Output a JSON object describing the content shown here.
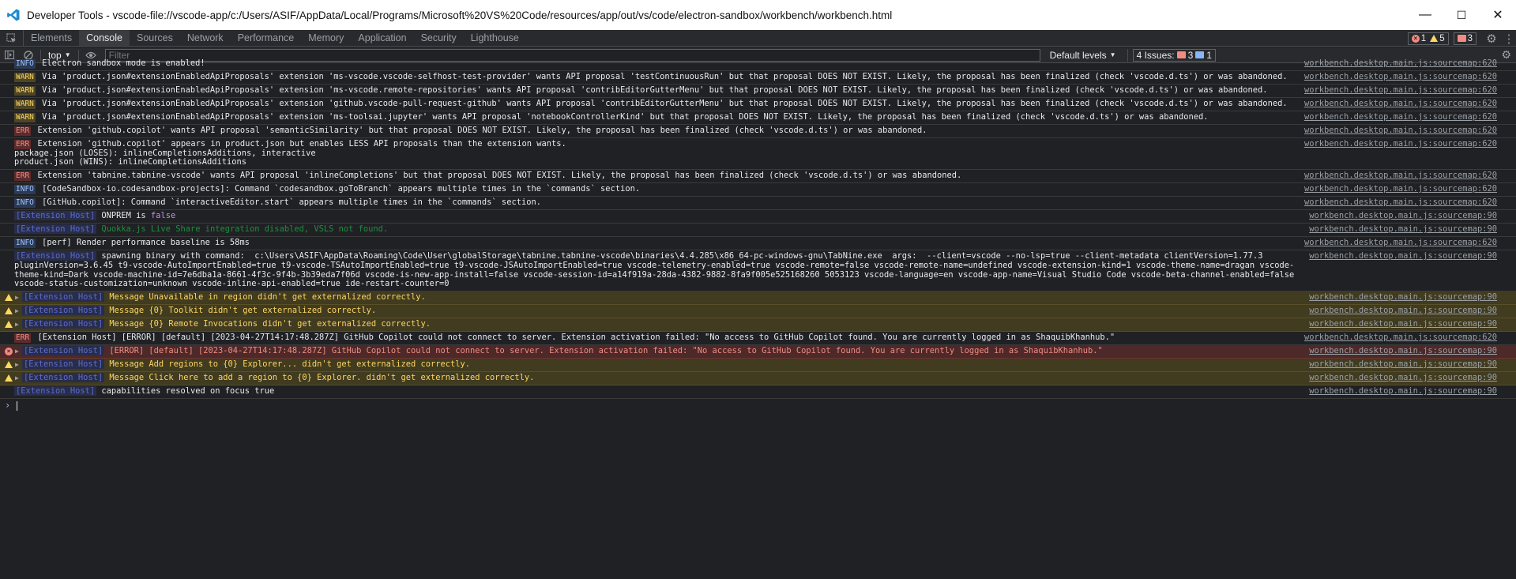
{
  "window": {
    "title": "Developer Tools - vscode-file://vscode-app/c:/Users/ASIF/AppData/Local/Programs/Microsoft%20VS%20Code/resources/app/out/vs/code/electron-sandbox/workbench/workbench.html",
    "minimize": "—",
    "maximize": "☐",
    "close": "✕",
    "icon": "vscode-icon"
  },
  "tabs": [
    {
      "label": "Elements"
    },
    {
      "label": "Console",
      "active": true
    },
    {
      "label": "Sources"
    },
    {
      "label": "Network"
    },
    {
      "label": "Performance"
    },
    {
      "label": "Memory"
    },
    {
      "label": "Application"
    },
    {
      "label": "Security"
    },
    {
      "label": "Lighthouse"
    }
  ],
  "counts": {
    "errors": "1",
    "warnings": "5",
    "messages": "3"
  },
  "toolbar": {
    "context": "top",
    "filter_placeholder": "Filter",
    "levels": "Default levels",
    "issues_label": "4 Issues:",
    "issues_errors": "3",
    "issues_info": "1"
  },
  "colors": {
    "background": "#202124",
    "warning_bg": "#413b1f",
    "error_bg": "#4e2929",
    "accent": "#8ab4f8"
  },
  "rows": [
    {
      "level": "INFO",
      "text": "Electron sandbox mode is enabled!",
      "src": "workbench.desktop.main.js:sourcemap:620"
    },
    {
      "level": "WARN",
      "text": "Via 'product.json#extensionEnabledApiProposals' extension 'ms-vscode.vscode-selfhost-test-provider' wants API proposal 'testContinuousRun' but that proposal DOES NOT EXIST. Likely, the proposal has been finalized (check 'vscode.d.ts') or was abandoned.",
      "src": "workbench.desktop.main.js:sourcemap:620"
    },
    {
      "level": "WARN",
      "text": "Via 'product.json#extensionEnabledApiProposals' extension 'ms-vscode.remote-repositories' wants API proposal 'contribEditorGutterMenu' but that proposal DOES NOT EXIST. Likely, the proposal has been finalized (check 'vscode.d.ts') or was abandoned.",
      "src": "workbench.desktop.main.js:sourcemap:620"
    },
    {
      "level": "WARN",
      "text": "Via 'product.json#extensionEnabledApiProposals' extension 'github.vscode-pull-request-github' wants API proposal 'contribEditorGutterMenu' but that proposal DOES NOT EXIST. Likely, the proposal has been finalized (check 'vscode.d.ts') or was abandoned.",
      "src": "workbench.desktop.main.js:sourcemap:620"
    },
    {
      "level": "WARN",
      "text": "Via 'product.json#extensionEnabledApiProposals' extension 'ms-toolsai.jupyter' wants API proposal 'notebookControllerKind' but that proposal DOES NOT EXIST. Likely, the proposal has been finalized (check 'vscode.d.ts') or was abandoned.",
      "src": "workbench.desktop.main.js:sourcemap:620"
    },
    {
      "level": "ERR",
      "text": "Extension 'github.copilot' wants API proposal 'semanticSimilarity' but that proposal DOES NOT EXIST. Likely, the proposal has been finalized (check 'vscode.d.ts') or was abandoned.",
      "src": "workbench.desktop.main.js:sourcemap:620"
    },
    {
      "level": "ERR",
      "text": "Extension 'github.copilot' appears in product.json but enables LESS API proposals than the extension wants.\npackage.json (LOSES): inlineCompletionsAdditions, interactive\nproduct.json (WINS): inlineCompletionsAdditions",
      "src": "workbench.desktop.main.js:sourcemap:620"
    },
    {
      "level": "ERR",
      "text": "Extension 'tabnine.tabnine-vscode' wants API proposal 'inlineCompletions' but that proposal DOES NOT EXIST. Likely, the proposal has been finalized (check 'vscode.d.ts') or was abandoned.",
      "src": "workbench.desktop.main.js:sourcemap:620"
    },
    {
      "level": "INFO",
      "text": "[CodeSandbox-io.codesandbox-projects]: Command `codesandbox.goToBranch` appears multiple times in the `commands` section.",
      "src": "workbench.desktop.main.js:sourcemap:620"
    },
    {
      "level": "INFO",
      "text": "[GitHub.copilot]: Command `interactiveEditor.start` appears multiple times in the `commands` section.",
      "src": "workbench.desktop.main.js:sourcemap:620"
    }
  ],
  "host_rows": {
    "tag": "[Extension Host]",
    "onprem_text": "ONPREM is ",
    "onprem_value": "false",
    "onprem_src": "workbench.desktop.main.js:sourcemap:90",
    "quokka_text": "Quokka.js Live Share integration disabled, VSLS not found.",
    "quokka_src": "workbench.desktop.main.js:sourcemap:90",
    "perf_level": "INFO",
    "perf_text": "[perf] Render performance baseline is 58ms",
    "perf_src": "workbench.desktop.main.js:sourcemap:620",
    "spawn_text": "spawning binary with command:  c:\\Users\\ASIF\\AppData\\Roaming\\Code\\User\\globalStorage\\tabnine.tabnine-vscode\\binaries\\4.4.285\\x86_64-pc-windows-gnu\\TabNine.exe  args:  --client=vscode --no-lsp=true --client-metadata clientVersion=1.77.3 pluginVersion=3.6.45 t9-vscode-AutoImportEnabled=true t9-vscode-TSAutoImportEnabled=true t9-vscode-JSAutoImportEnabled=true vscode-telemetry-enabled=true vscode-remote=false vscode-remote-name=undefined vscode-extension-kind=1 vscode-theme-name=dragan vscode-theme-kind=Dark vscode-machine-id=7e6dba1a-8661-4f3c-9f4b-3b39eda7f06d vscode-is-new-app-install=false vscode-session-id=a14f919a-28da-4382-9882-8fa9f005e525168260 5053123 vscode-language=en vscode-app-name=Visual Studio Code vscode-beta-channel-enabled=false vscode-status-customization=unknown vscode-inline-api-enabled=true ide-restart-counter=0",
    "spawn_src": "workbench.desktop.main.js:sourcemap:90",
    "warn1": "Message Unavailable in region didn't get externalized correctly.",
    "warn2": "Message {0} Toolkit didn't get externalized correctly.",
    "warn3": "Message {0} Remote Invocations didn't get externalized correctly.",
    "err_plain_level": "ERR",
    "err_plain": "[Extension Host] [ERROR] [default] [2023-04-27T14:17:48.287Z] GitHub Copilot could not connect to server. Extension activation failed: \"No access to GitHub Copilot found. You are currently logged in as ShaquibKhanhub.\"",
    "err_plain_src": "workbench.desktop.main.js:sourcemap:620",
    "err_red": "[ERROR] [default] [2023-04-27T14:17:48.287Z] GitHub Copilot could not connect to server. Extension activation failed: \"No access to GitHub Copilot found. You are currently logged in as ShaquibKhanhub.\"",
    "warn4": "Message Add regions to {0} Explorer... didn't get externalized correctly.",
    "warn5": "Message Click here to add a region to {0} Explorer. didn't get externalized correctly.",
    "caps": "capabilities resolved on focus true",
    "src90": "workbench.desktop.main.js:sourcemap:90"
  }
}
